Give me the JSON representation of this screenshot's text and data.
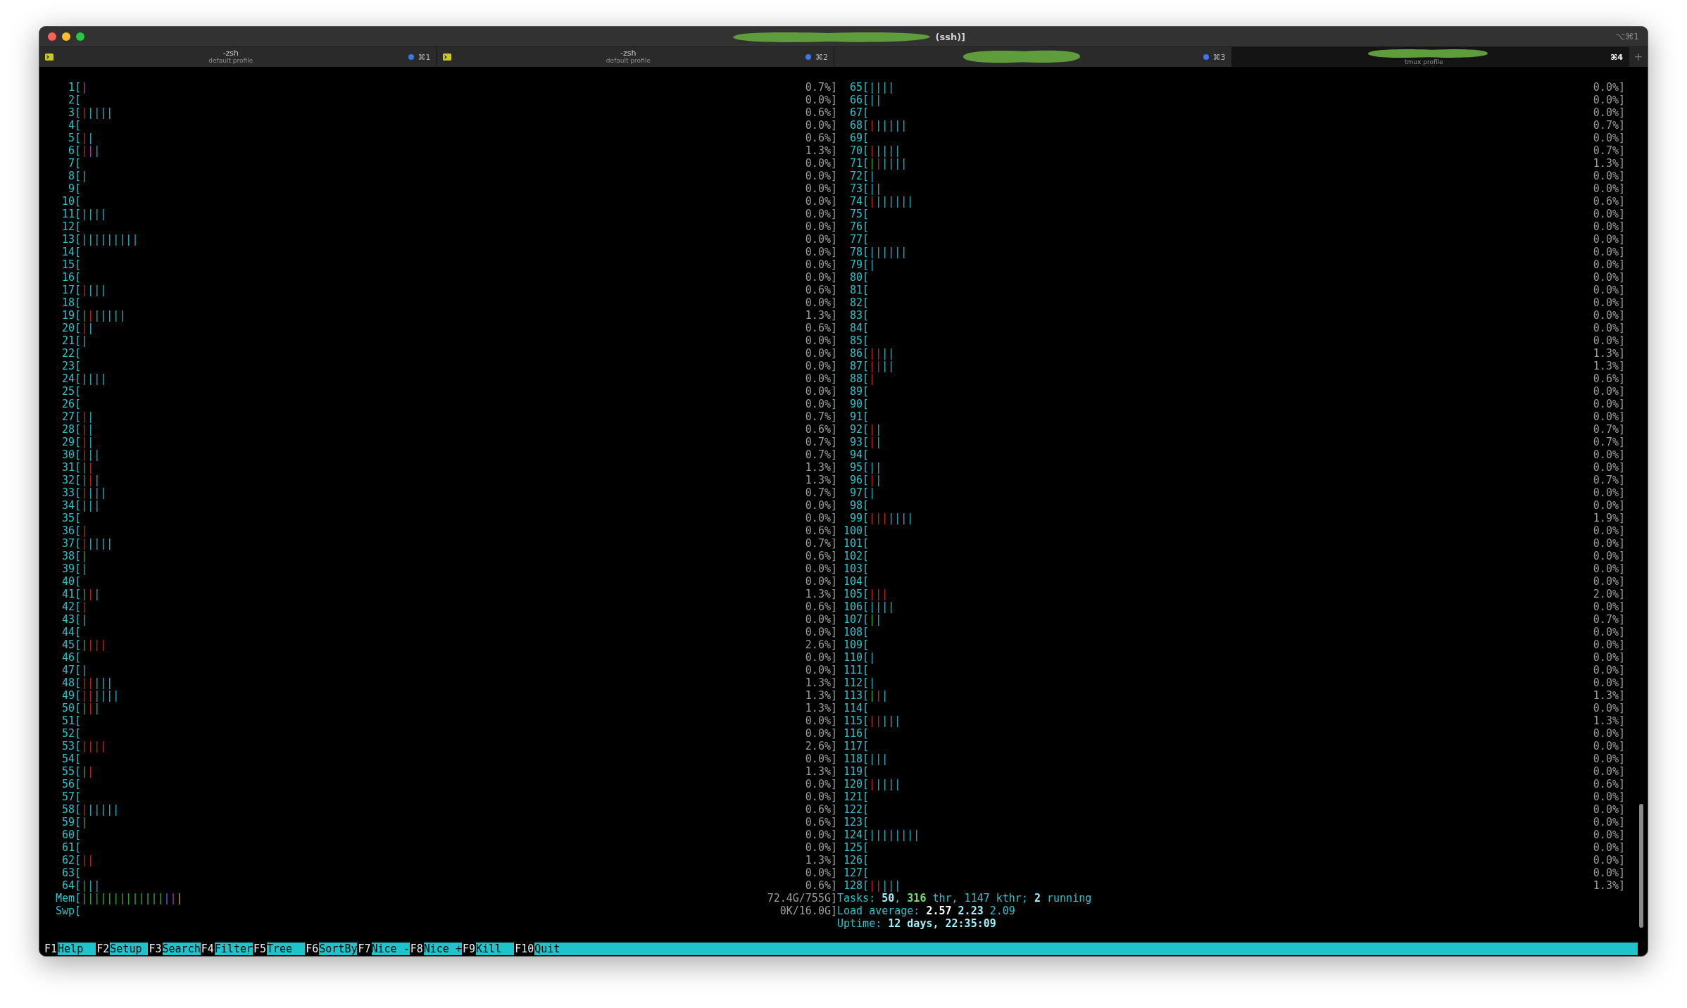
{
  "window": {
    "title": "(ssh)]",
    "shortcut": "⌥⌘1"
  },
  "tabs": [
    {
      "kind": "shell",
      "title": "-zsh",
      "subtitle": "default profile",
      "shortcut": "⌘1",
      "activity": true,
      "selected": false
    },
    {
      "kind": "shell",
      "title": "-zsh",
      "subtitle": "default profile",
      "shortcut": "⌘2",
      "activity": true,
      "selected": false
    },
    {
      "kind": "redacted",
      "shortcut": "⌘3",
      "activity": true,
      "selected": false
    },
    {
      "kind": "redacted",
      "subtitle": "tmux profile",
      "shortcut": "⌘4",
      "activity": false,
      "selected": true
    }
  ],
  "new_tab": "+",
  "left_meters": [
    {
      "label": "1[",
      "bar": [
        {
          "kind": "irq",
          "text": "|"
        }
      ],
      "reading": "0.7%]"
    },
    {
      "label": "2[",
      "reading": "0.0%]"
    },
    {
      "label": "3[",
      "bar": [
        {
          "kind": "system",
          "text": "|"
        },
        {
          "kind": "virt",
          "text": "||||"
        }
      ],
      "reading": "0.6%]"
    },
    {
      "label": "4[",
      "reading": "0.0%]"
    },
    {
      "label": "5[",
      "bar": [
        {
          "kind": "system",
          "text": "|"
        },
        {
          "kind": "virt",
          "text": "|"
        }
      ],
      "reading": "0.6%]"
    },
    {
      "label": "6[",
      "bar": [
        {
          "kind": "system",
          "text": "|"
        },
        {
          "kind": "irq",
          "text": "|"
        },
        {
          "kind": "virt",
          "text": "|"
        }
      ],
      "reading": "1.3%]"
    },
    {
      "label": "7[",
      "reading": "0.0%]"
    },
    {
      "label": "8[",
      "bar": [
        {
          "kind": "virt",
          "text": "|"
        }
      ],
      "reading": "0.0%]"
    },
    {
      "label": "9[",
      "reading": "0.0%]"
    },
    {
      "label": "10[",
      "reading": "0.0%]"
    },
    {
      "label": "11[",
      "bar": [
        {
          "kind": "virt",
          "text": "||||"
        }
      ],
      "reading": "0.0%]"
    },
    {
      "label": "12[",
      "reading": "0.0%]"
    },
    {
      "label": "13[",
      "bar": [
        {
          "kind": "virt",
          "text": "|||||||||"
        }
      ],
      "reading": "0.0%]"
    },
    {
      "label": "14[",
      "reading": "0.0%]"
    },
    {
      "label": "15[",
      "reading": "0.0%]"
    },
    {
      "label": "16[",
      "reading": "0.0%]"
    },
    {
      "label": "17[",
      "bar": [
        {
          "kind": "system",
          "text": "|"
        },
        {
          "kind": "virt",
          "text": "|||"
        }
      ],
      "reading": "0.6%]"
    },
    {
      "label": "18[",
      "reading": "0.0%]"
    },
    {
      "label": "19[",
      "bar": [
        {
          "kind": "user",
          "text": "|"
        },
        {
          "kind": "system",
          "text": "|"
        },
        {
          "kind": "virt",
          "text": "|||||"
        }
      ],
      "reading": "1.3%]"
    },
    {
      "label": "20[",
      "bar": [
        {
          "kind": "system",
          "text": "|"
        },
        {
          "kind": "virt",
          "text": "|"
        }
      ],
      "reading": "0.6%]"
    },
    {
      "label": "21[",
      "bar": [
        {
          "kind": "virt",
          "text": "|"
        }
      ],
      "reading": "0.0%]"
    },
    {
      "label": "22[",
      "reading": "0.0%]"
    },
    {
      "label": "23[",
      "reading": "0.0%]"
    },
    {
      "label": "24[",
      "bar": [
        {
          "kind": "virt",
          "text": "||||"
        }
      ],
      "reading": "0.0%]"
    },
    {
      "label": "25[",
      "reading": "0.0%]"
    },
    {
      "label": "26[",
      "reading": "0.0%]"
    },
    {
      "label": "27[",
      "bar": [
        {
          "kind": "system",
          "text": "|"
        },
        {
          "kind": "virt",
          "text": "|"
        }
      ],
      "reading": "0.7%]"
    },
    {
      "label": "28[",
      "bar": [
        {
          "kind": "system",
          "text": "|"
        },
        {
          "kind": "virt",
          "text": "|"
        }
      ],
      "reading": "0.6%]"
    },
    {
      "label": "29[",
      "bar": [
        {
          "kind": "system",
          "text": "|"
        },
        {
          "kind": "virt",
          "text": "|"
        }
      ],
      "reading": "0.7%]"
    },
    {
      "label": "30[",
      "bar": [
        {
          "kind": "system",
          "text": "|"
        },
        {
          "kind": "virt",
          "text": "||"
        }
      ],
      "reading": "0.7%]"
    },
    {
      "label": "31[",
      "bar": [
        {
          "kind": "user",
          "text": "|"
        },
        {
          "kind": "system",
          "text": "|"
        }
      ],
      "reading": "1.3%]"
    },
    {
      "label": "32[",
      "bar": [
        {
          "kind": "user",
          "text": "|"
        },
        {
          "kind": "system",
          "text": "|"
        },
        {
          "kind": "virt",
          "text": "|"
        }
      ],
      "reading": "1.3%]"
    },
    {
      "label": "33[",
      "bar": [
        {
          "kind": "system",
          "text": "|"
        },
        {
          "kind": "virt",
          "text": "|||"
        }
      ],
      "reading": "0.7%]"
    },
    {
      "label": "34[",
      "bar": [
        {
          "kind": "virt",
          "text": "|||"
        }
      ],
      "reading": "0.0%]"
    },
    {
      "label": "35[",
      "reading": "0.0%]"
    },
    {
      "label": "36[",
      "bar": [
        {
          "kind": "system",
          "text": "|"
        }
      ],
      "reading": "0.6%]"
    },
    {
      "label": "37[",
      "bar": [
        {
          "kind": "system",
          "text": "|"
        },
        {
          "kind": "virt",
          "text": "||||"
        }
      ],
      "reading": "0.7%]"
    },
    {
      "label": "38[",
      "bar": [
        {
          "kind": "user",
          "text": "|"
        }
      ],
      "reading": "0.6%]"
    },
    {
      "label": "39[",
      "bar": [
        {
          "kind": "virt",
          "text": "|"
        }
      ],
      "reading": "0.0%]"
    },
    {
      "label": "40[",
      "reading": "0.0%]"
    },
    {
      "label": "41[",
      "bar": [
        {
          "kind": "user",
          "text": "|"
        },
        {
          "kind": "system",
          "text": "|"
        },
        {
          "kind": "virt",
          "text": "|"
        }
      ],
      "reading": "1.3%]"
    },
    {
      "label": "42[",
      "bar": [
        {
          "kind": "system",
          "text": "|"
        }
      ],
      "reading": "0.6%]"
    },
    {
      "label": "43[",
      "bar": [
        {
          "kind": "virt",
          "text": "|"
        }
      ],
      "reading": "0.0%]"
    },
    {
      "label": "44[",
      "reading": "0.0%]"
    },
    {
      "label": "45[",
      "bar": [
        {
          "kind": "user",
          "text": "|"
        },
        {
          "kind": "system",
          "text": "|||"
        }
      ],
      "reading": "2.6%]"
    },
    {
      "label": "46[",
      "reading": "0.0%]"
    },
    {
      "label": "47[",
      "bar": [
        {
          "kind": "virt",
          "text": "|"
        }
      ],
      "reading": "0.0%]"
    },
    {
      "label": "48[",
      "bar": [
        {
          "kind": "system",
          "text": "||"
        },
        {
          "kind": "virt",
          "text": "|||"
        }
      ],
      "reading": "1.3%]"
    },
    {
      "label": "49[",
      "bar": [
        {
          "kind": "system",
          "text": "||"
        },
        {
          "kind": "virt",
          "text": "||||"
        }
      ],
      "reading": "1.3%]"
    },
    {
      "label": "50[",
      "bar": [
        {
          "kind": "user",
          "text": "|"
        },
        {
          "kind": "system",
          "text": "|"
        },
        {
          "kind": "virt",
          "text": "|"
        }
      ],
      "reading": "1.3%]"
    },
    {
      "label": "51[",
      "reading": "0.0%]"
    },
    {
      "label": "52[",
      "reading": "0.0%]"
    },
    {
      "label": "53[",
      "bar": [
        {
          "kind": "system",
          "text": "||||"
        }
      ],
      "reading": "2.6%]"
    },
    {
      "label": "54[",
      "reading": "0.0%]"
    },
    {
      "label": "55[",
      "bar": [
        {
          "kind": "user",
          "text": "|"
        },
        {
          "kind": "system",
          "text": "|"
        }
      ],
      "reading": "1.3%]"
    },
    {
      "label": "56[",
      "reading": "0.0%]"
    },
    {
      "label": "57[",
      "reading": "0.0%]"
    },
    {
      "label": "58[",
      "bar": [
        {
          "kind": "system",
          "text": "|"
        },
        {
          "kind": "virt",
          "text": "|||||"
        }
      ],
      "reading": "0.6%]"
    },
    {
      "label": "59[",
      "bar": [
        {
          "kind": "user",
          "text": "|"
        }
      ],
      "reading": "0.6%]"
    },
    {
      "label": "60[",
      "reading": "0.0%]"
    },
    {
      "label": "61[",
      "reading": "0.0%]"
    },
    {
      "label": "62[",
      "bar": [
        {
          "kind": "system",
          "text": "||"
        }
      ],
      "reading": "1.3%]"
    },
    {
      "label": "63[",
      "reading": "0.0%]"
    },
    {
      "label": "64[",
      "bar": [
        {
          "kind": "user",
          "text": "|"
        },
        {
          "kind": "virt",
          "text": "||"
        }
      ],
      "reading": "0.6%]"
    },
    {
      "label": "Mem[",
      "bar": [
        {
          "kind": "used",
          "text": "|||||||||||||"
        },
        {
          "kind": "buffers",
          "text": "|"
        },
        {
          "kind": "shared",
          "text": "|"
        },
        {
          "kind": "cache",
          "text": "|"
        }
      ],
      "reading": "72.4G/755G]"
    },
    {
      "label": "Swp[",
      "reading": "0K/16.0G]"
    }
  ],
  "right_meters": [
    {
      "label": "65[",
      "bar": [
        {
          "kind": "virt",
          "text": "||||"
        }
      ],
      "reading": "0.0%]"
    },
    {
      "label": "66[",
      "bar": [
        {
          "kind": "virt",
          "text": "||"
        }
      ],
      "reading": "0.0%]"
    },
    {
      "label": "67[",
      "reading": "0.0%]"
    },
    {
      "label": "68[",
      "bar": [
        {
          "kind": "system",
          "text": "|"
        },
        {
          "kind": "virt",
          "text": "|||||"
        }
      ],
      "reading": "0.7%]"
    },
    {
      "label": "69[",
      "reading": "0.0%]"
    },
    {
      "label": "70[",
      "bar": [
        {
          "kind": "system",
          "text": "|"
        },
        {
          "kind": "virt",
          "text": "||||"
        }
      ],
      "reading": "0.7%]"
    },
    {
      "label": "71[",
      "bar": [
        {
          "kind": "user",
          "text": "|"
        },
        {
          "kind": "system",
          "text": "|"
        },
        {
          "kind": "virt",
          "text": "||||"
        }
      ],
      "reading": "1.3%]"
    },
    {
      "label": "72[",
      "bar": [
        {
          "kind": "virt",
          "text": "|"
        }
      ],
      "reading": "0.0%]"
    },
    {
      "label": "73[",
      "bar": [
        {
          "kind": "virt",
          "text": "||"
        }
      ],
      "reading": "0.0%]"
    },
    {
      "label": "74[",
      "bar": [
        {
          "kind": "system",
          "text": "|"
        },
        {
          "kind": "virt",
          "text": "||||||"
        }
      ],
      "reading": "0.6%]"
    },
    {
      "label": "75[",
      "reading": "0.0%]"
    },
    {
      "label": "76[",
      "reading": "0.0%]"
    },
    {
      "label": "77[",
      "reading": "0.0%]"
    },
    {
      "label": "78[",
      "bar": [
        {
          "kind": "virt",
          "text": "||||||"
        }
      ],
      "reading": "0.0%]"
    },
    {
      "label": "79[",
      "bar": [
        {
          "kind": "virt",
          "text": "|"
        }
      ],
      "reading": "0.0%]"
    },
    {
      "label": "80[",
      "reading": "0.0%]"
    },
    {
      "label": "81[",
      "reading": "0.0%]"
    },
    {
      "label": "82[",
      "reading": "0.0%]"
    },
    {
      "label": "83[",
      "reading": "0.0%]"
    },
    {
      "label": "84[",
      "reading": "0.0%]"
    },
    {
      "label": "85[",
      "reading": "0.0%]"
    },
    {
      "label": "86[",
      "bar": [
        {
          "kind": "system",
          "text": "||"
        },
        {
          "kind": "virt",
          "text": "||"
        }
      ],
      "reading": "1.3%]"
    },
    {
      "label": "87[",
      "bar": [
        {
          "kind": "system",
          "text": "||"
        },
        {
          "kind": "virt",
          "text": "||"
        }
      ],
      "reading": "1.3%]"
    },
    {
      "label": "88[",
      "bar": [
        {
          "kind": "system",
          "text": "|"
        }
      ],
      "reading": "0.6%]"
    },
    {
      "label": "89[",
      "reading": "0.0%]"
    },
    {
      "label": "90[",
      "reading": "0.0%]"
    },
    {
      "label": "91[",
      "reading": "0.0%]"
    },
    {
      "label": "92[",
      "bar": [
        {
          "kind": "system",
          "text": "|"
        },
        {
          "kind": "virt",
          "text": "|"
        }
      ],
      "reading": "0.7%]"
    },
    {
      "label": "93[",
      "bar": [
        {
          "kind": "system",
          "text": "|"
        },
        {
          "kind": "virt",
          "text": "|"
        }
      ],
      "reading": "0.7%]"
    },
    {
      "label": "94[",
      "reading": "0.0%]"
    },
    {
      "label": "95[",
      "bar": [
        {
          "kind": "virt",
          "text": "||"
        }
      ],
      "reading": "0.0%]"
    },
    {
      "label": "96[",
      "bar": [
        {
          "kind": "system",
          "text": "|"
        },
        {
          "kind": "virt",
          "text": "|"
        }
      ],
      "reading": "0.7%]"
    },
    {
      "label": "97[",
      "bar": [
        {
          "kind": "virt",
          "text": "|"
        }
      ],
      "reading": "0.0%]"
    },
    {
      "label": "98[",
      "reading": "0.0%]"
    },
    {
      "label": "99[",
      "bar": [
        {
          "kind": "system",
          "text": "|||"
        },
        {
          "kind": "virt",
          "text": "||||"
        }
      ],
      "reading": "1.9%]"
    },
    {
      "label": "100[",
      "reading": "0.0%]"
    },
    {
      "label": "101[",
      "reading": "0.0%]"
    },
    {
      "label": "102[",
      "reading": "0.0%]"
    },
    {
      "label": "103[",
      "reading": "0.0%]"
    },
    {
      "label": "104[",
      "reading": "0.0%]"
    },
    {
      "label": "105[",
      "bar": [
        {
          "kind": "system",
          "text": "|||"
        }
      ],
      "reading": "2.0%]"
    },
    {
      "label": "106[",
      "bar": [
        {
          "kind": "virt",
          "text": "||||"
        }
      ],
      "reading": "0.0%]"
    },
    {
      "label": "107[",
      "bar": [
        {
          "kind": "user",
          "text": "|"
        },
        {
          "kind": "virt",
          "text": "|"
        }
      ],
      "reading": "0.7%]"
    },
    {
      "label": "108[",
      "reading": "0.0%]"
    },
    {
      "label": "109[",
      "reading": "0.0%]"
    },
    {
      "label": "110[",
      "bar": [
        {
          "kind": "virt",
          "text": "|"
        }
      ],
      "reading": "0.0%]"
    },
    {
      "label": "111[",
      "reading": "0.0%]"
    },
    {
      "label": "112[",
      "bar": [
        {
          "kind": "virt",
          "text": "|"
        }
      ],
      "reading": "0.0%]"
    },
    {
      "label": "113[",
      "bar": [
        {
          "kind": "user",
          "text": "|"
        },
        {
          "kind": "system",
          "text": "|"
        },
        {
          "kind": "virt",
          "text": "|"
        }
      ],
      "reading": "1.3%]"
    },
    {
      "label": "114[",
      "reading": "0.0%]"
    },
    {
      "label": "115[",
      "bar": [
        {
          "kind": "system",
          "text": "||"
        },
        {
          "kind": "virt",
          "text": "|||"
        }
      ],
      "reading": "1.3%]"
    },
    {
      "label": "116[",
      "reading": "0.0%]"
    },
    {
      "label": "117[",
      "reading": "0.0%]"
    },
    {
      "label": "118[",
      "bar": [
        {
          "kind": "virt",
          "text": "|||"
        }
      ],
      "reading": "0.0%]"
    },
    {
      "label": "119[",
      "reading": "0.0%]"
    },
    {
      "label": "120[",
      "bar": [
        {
          "kind": "system",
          "text": "|"
        },
        {
          "kind": "virt",
          "text": "||||"
        }
      ],
      "reading": "0.6%]"
    },
    {
      "label": "121[",
      "reading": "0.0%]"
    },
    {
      "label": "122[",
      "reading": "0.0%]"
    },
    {
      "label": "123[",
      "reading": "0.0%]"
    },
    {
      "label": "124[",
      "bar": [
        {
          "kind": "virt",
          "text": "||||||||"
        }
      ],
      "reading": "0.0%]"
    },
    {
      "label": "125[",
      "reading": "0.0%]"
    },
    {
      "label": "126[",
      "reading": "0.0%]"
    },
    {
      "label": "127[",
      "reading": "0.0%]"
    },
    {
      "label": "128[",
      "bar": [
        {
          "kind": "system",
          "text": "||"
        },
        {
          "kind": "virt",
          "text": "|||"
        }
      ],
      "reading": "1.3%]"
    }
  ],
  "info_lines": [
    [
      {
        "kind": "text",
        "text": "Tasks: "
      },
      {
        "kind": "value",
        "text": "50"
      },
      {
        "kind": "text",
        "text": ", "
      },
      {
        "kind": "threads",
        "text": "316"
      },
      {
        "kind": "text",
        "text": " thr, 1147 kthr; "
      },
      {
        "kind": "value",
        "text": "2"
      },
      {
        "kind": "text",
        "text": " running"
      }
    ],
    [
      {
        "kind": "text",
        "text": "Load average: "
      },
      {
        "kind": "strong",
        "text": "2.57 "
      },
      {
        "kind": "value",
        "text": "2.23 "
      },
      {
        "kind": "text",
        "text": "2.09"
      }
    ],
    [
      {
        "kind": "text",
        "text": "Uptime: "
      },
      {
        "kind": "value",
        "text": "12 days, 22:35:09"
      }
    ]
  ],
  "function_keys": [
    {
      "key": "F1",
      "label": "Help"
    },
    {
      "key": "F2",
      "label": "Setup"
    },
    {
      "key": "F3",
      "label": "Search"
    },
    {
      "key": "F4",
      "label": "Filter"
    },
    {
      "key": "F5",
      "label": "Tree"
    },
    {
      "key": "F6",
      "label": "SortBy"
    },
    {
      "key": "F7",
      "label": "Nice -"
    },
    {
      "key": "F8",
      "label": "Nice +"
    },
    {
      "key": "F9",
      "label": "Kill"
    },
    {
      "key": "F10",
      "label": "Quit"
    }
  ]
}
